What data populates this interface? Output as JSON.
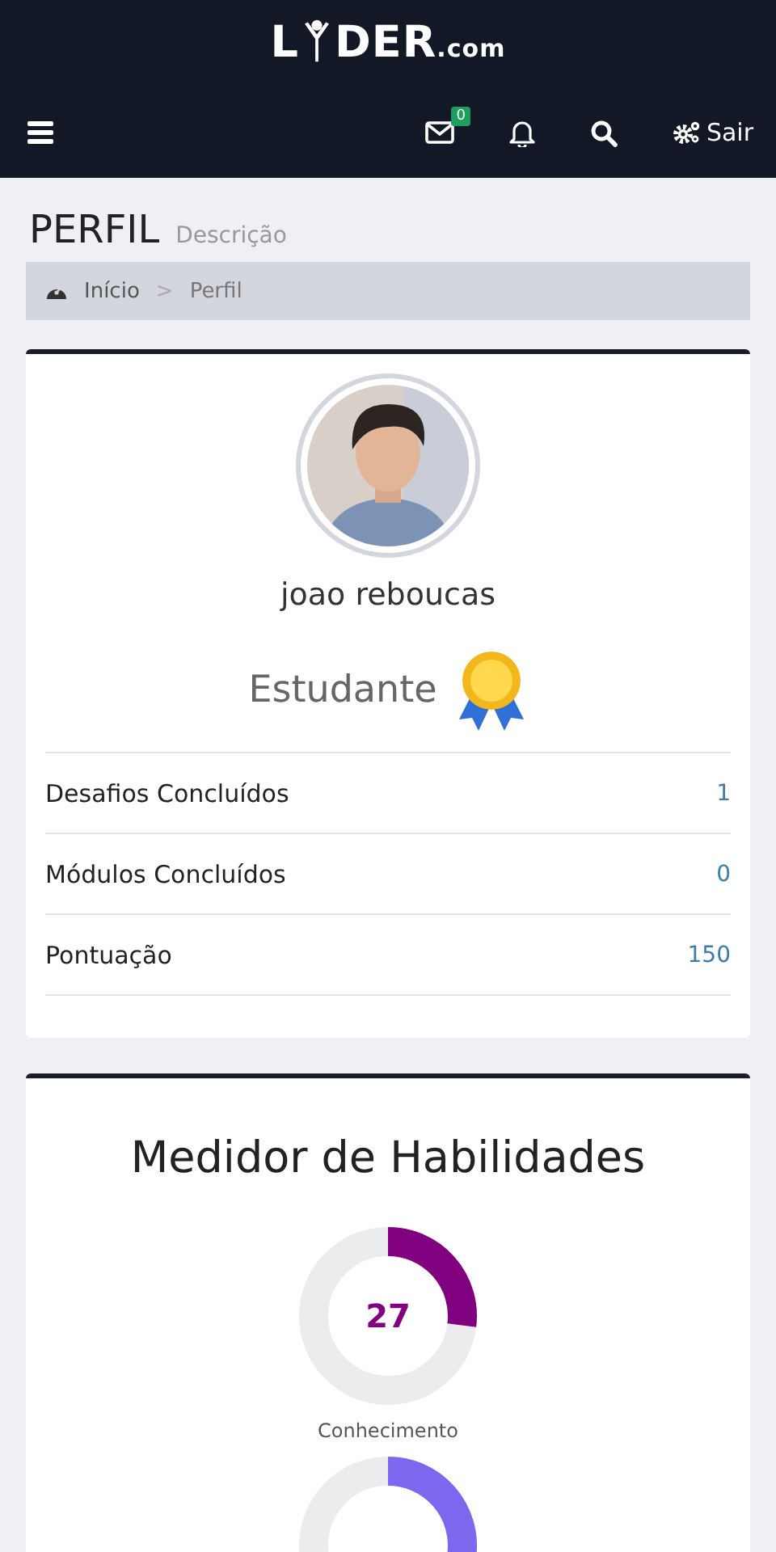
{
  "logo": {
    "start": "L",
    "middle": "DER",
    "suffix": ".com"
  },
  "nav": {
    "messages_badge": "0",
    "logout": "Sair"
  },
  "page": {
    "title": "PERFIL",
    "subtitle": "Descrição"
  },
  "breadcrumb": [
    {
      "label": "Início"
    },
    {
      "label": "Perfil"
    }
  ],
  "breadcrumb_separator": ">",
  "profile": {
    "name": "joao reboucas",
    "role": "Estudante",
    "stats": [
      {
        "label": "Desafios Concluídos",
        "value": "1"
      },
      {
        "label": "Módulos Concluídos",
        "value": "0"
      },
      {
        "label": "Pontuação",
        "value": "150"
      }
    ]
  },
  "skills": {
    "title": "Medidor de Habilidades",
    "meters": [
      {
        "value": "27",
        "label": "Conhecimento",
        "color": "#800080"
      },
      {
        "color": "#7b68ee"
      }
    ]
  }
}
